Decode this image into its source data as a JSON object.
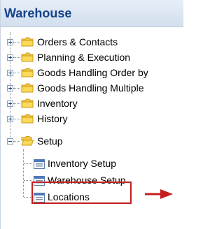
{
  "panel": {
    "title": "Warehouse"
  },
  "tree": {
    "items": [
      {
        "label": "Orders & Contacts",
        "expanded": false
      },
      {
        "label": "Planning & Execution",
        "expanded": false
      },
      {
        "label": "Goods Handling Order by",
        "expanded": false
      },
      {
        "label": "Goods Handling Multiple",
        "expanded": false
      },
      {
        "label": "Inventory",
        "expanded": false
      },
      {
        "label": "History",
        "expanded": false
      },
      {
        "label": "Setup",
        "expanded": true
      }
    ],
    "setup_children": [
      {
        "label": "Inventory Setup"
      },
      {
        "label": "Warehouse Setup"
      },
      {
        "label": "Locations"
      }
    ]
  },
  "colors": {
    "header_text": "#15428b",
    "highlight": "#c41e1e",
    "folder": "#f5c842"
  }
}
